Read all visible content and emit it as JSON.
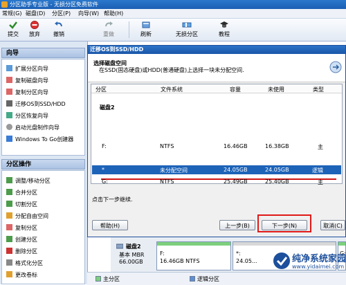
{
  "window": {
    "title": "分区助手专业版 - 无损分区免费软件"
  },
  "menu": [
    "常规(G)",
    "磁盘(D)",
    "分区(P)",
    "向导(W)",
    "帮助(H)"
  ],
  "toolbar": {
    "submit": "提交",
    "discard": "放弃",
    "undo": "撤销",
    "redo": "重做",
    "refresh": "刷新",
    "lossless": "无损分区",
    "tutorial": "教程"
  },
  "wizard": {
    "header": "向导",
    "items": [
      "扩展分区向导",
      "复制磁盘向导",
      "复制分区向导",
      "迁移OS到SSD/HDD",
      "分区恢复向导",
      "启动光盘制作向导",
      "Windows To Go创建器"
    ]
  },
  "partition_ops": {
    "header": "分区操作",
    "items": [
      "调整/移动分区",
      "合并分区",
      "切割分区",
      "分配自由空间",
      "复制分区",
      "创建分区",
      "删除分区",
      "格式化分区",
      "更改卷标"
    ]
  },
  "dialog": {
    "title": "迁移OS到SSD/HDD",
    "heading": "选择磁盘空间",
    "subheading": "在SSD(固态硬盘)或HDD(普通硬盘)上选择一块未分配空间.",
    "columns": [
      "分区",
      "文件系统",
      "容量",
      "未使用",
      "类型"
    ],
    "disk_label": "磁盘2",
    "rows": [
      {
        "partition": "F:",
        "fs": "NTFS",
        "capacity": "16.46GB",
        "unused": "16.38GB",
        "type": "主"
      },
      {
        "partition": "*",
        "fs": "未分配空间",
        "capacity": "24.05GB",
        "unused": "24.05GB",
        "type": "逻辑"
      },
      {
        "partition": "G:",
        "fs": "NTFS",
        "capacity": "25.49GB",
        "unused": "25.40GB",
        "type": "主"
      }
    ],
    "hint": "点击下一步继续.",
    "help_button": "帮助(H)",
    "prev_button": "上一步(B)",
    "next_button": "下一步(N)",
    "cancel_button": "取消(C)"
  },
  "diskmap": {
    "disk_name": "磁盘2",
    "disk_type": "基本 MBR",
    "disk_size": "66.00GB",
    "blocks": [
      {
        "name": "F:",
        "detail": "16.46GB NTFS"
      },
      {
        "name": "*:",
        "detail": "24.05..."
      },
      {
        "name": "G:",
        "detail": ""
      }
    ]
  },
  "legend": [
    "主分区",
    "逻辑分区"
  ],
  "watermark": {
    "title": "纯净系统家园",
    "url": "www.yidaimei.com"
  },
  "colors": {
    "accent": "#1d63b8",
    "highlight_red": "#e01818",
    "block_bar": "#7dd07d"
  }
}
